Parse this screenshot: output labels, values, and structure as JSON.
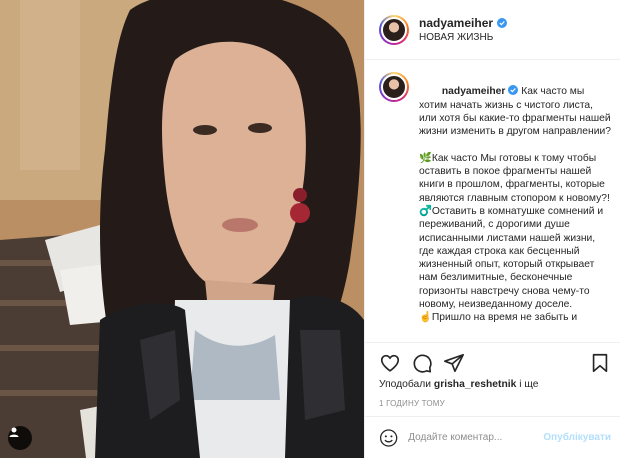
{
  "post": {
    "username": "nadyameiher",
    "location": "НОВАЯ ЖИЗНЬ",
    "caption_user": "nadyameiher",
    "caption_lines": [
      " Как часто мы хотим начать жизнь с чистого листа, или хотя бы какие-то фрагменты нашей жизни изменить в другом направлении?",
      "🌿Как часто Мы готовы к тому чтобы оставить в покое фрагменты нашей книги в прошлом, фрагменты, которые являются главным стопором к новому?!",
      "♂️Оставить в комнатушке сомнений и переживаний, с дорогими душе исписанными листами нашей жизни, где каждая строка как бесценный жизненный опыт, который открывает нам безлимитные, бесконечные горизонты навстречу снова чему-то новому, неизведанному доселе.",
      "☝️Пришло на время не забыть и"
    ],
    "likes_prefix": "Уподобали",
    "likes_user": "grisha_reshetnik",
    "likes_suffix": "і ще",
    "timestamp": "1 ГОДИНУ ТОМУ",
    "comment_placeholder": "Додайте коментар...",
    "publish_label": "Опублікувати"
  },
  "icons": {
    "verified": "verified-badge-icon",
    "like": "heart-icon",
    "comment": "comment-icon",
    "share": "share-icon",
    "save": "bookmark-icon",
    "emoji": "emoji-icon",
    "user_tag": "user-tag-icon"
  },
  "colors": {
    "verified": "#3897f0",
    "publish_disabled": "#b2dffc",
    "muted": "#8e8e8e"
  }
}
